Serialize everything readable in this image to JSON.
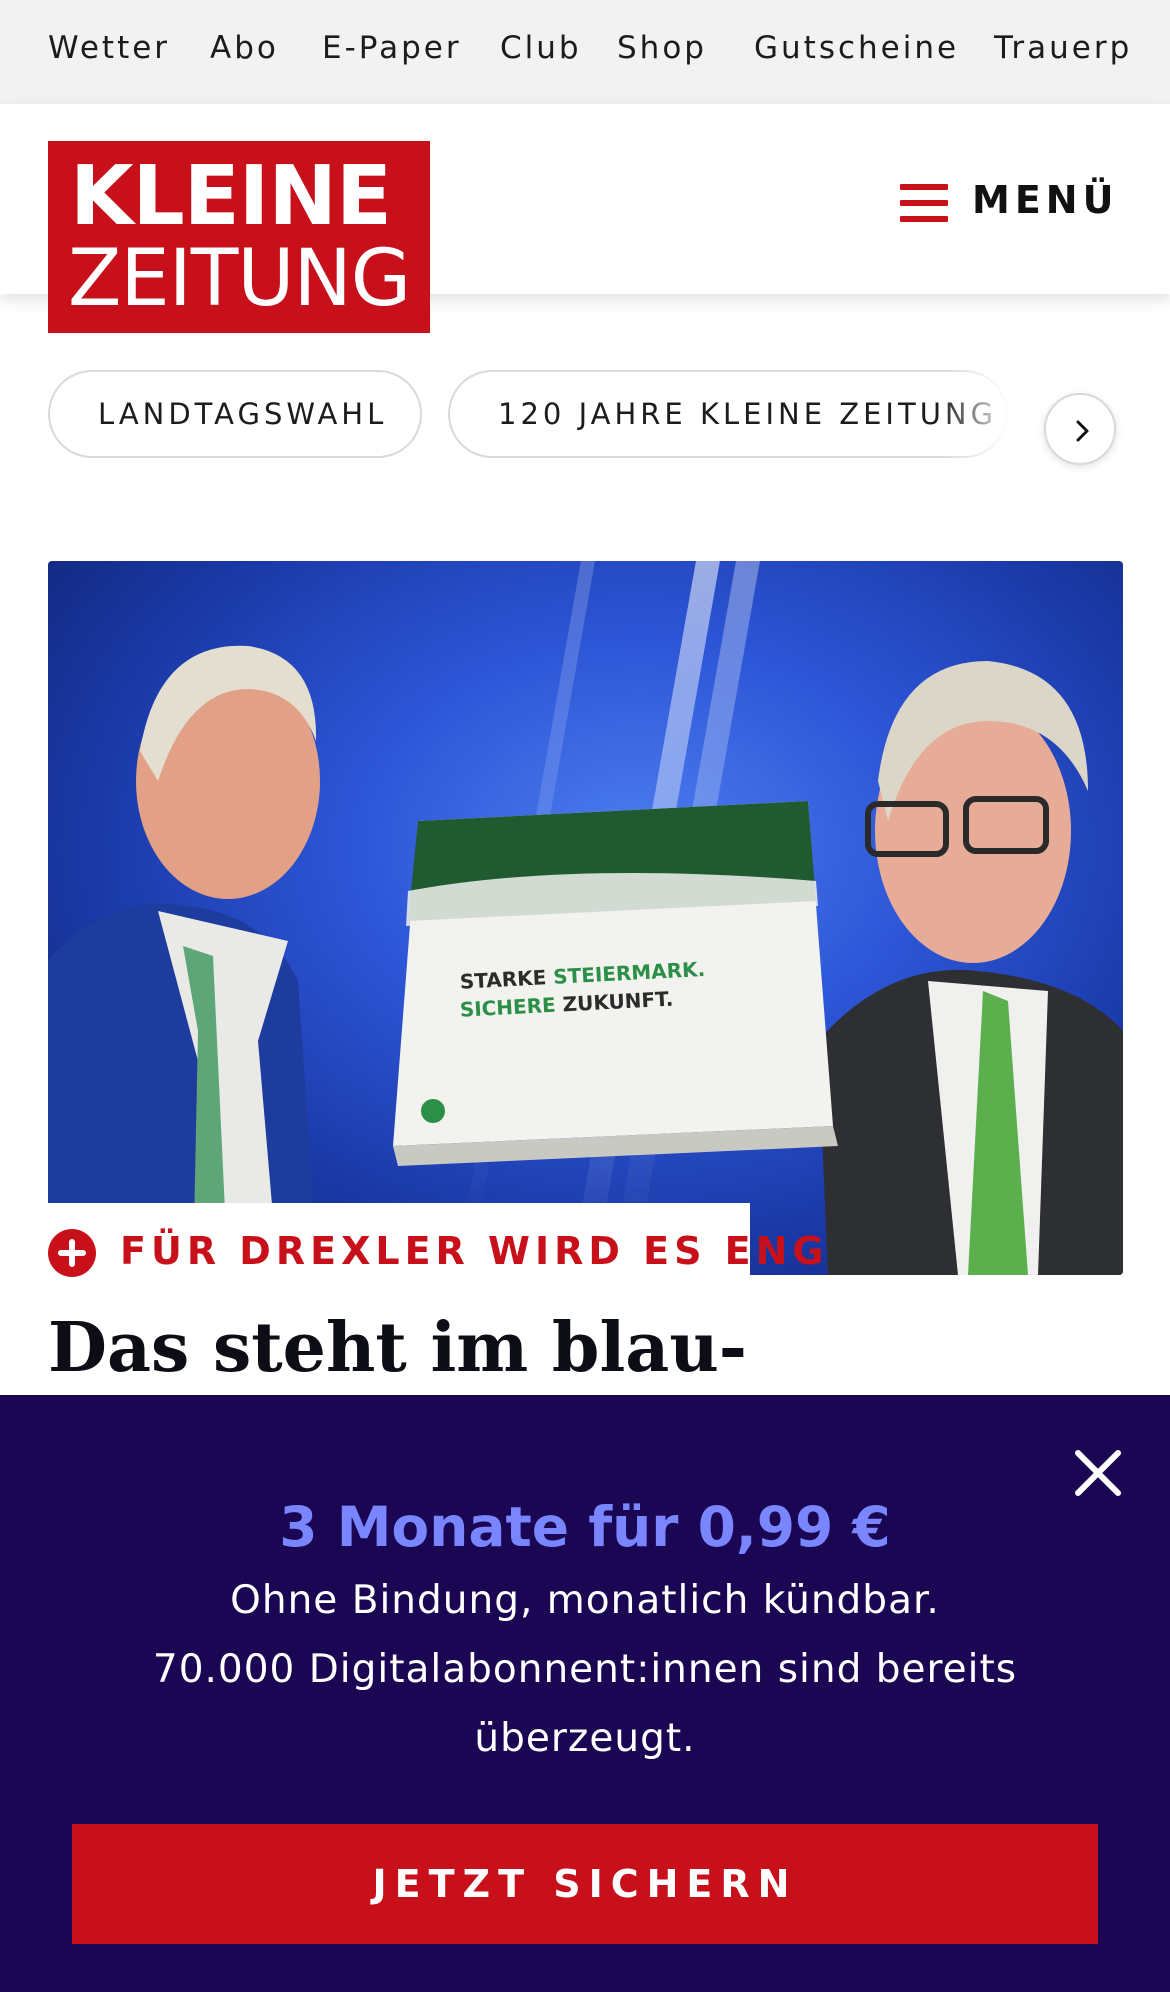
{
  "topbar": {
    "items": [
      "Wetter",
      "Abo",
      "E-Paper",
      "Club",
      "Shop",
      "Gutscheine",
      "Trauerp"
    ]
  },
  "header": {
    "logo_line1": "KLEINE",
    "logo_line2": "ZEITUNG",
    "menu_label": "MENÜ",
    "brand_color": "#c8101a"
  },
  "chips": {
    "items": [
      "LANDTAGSWAHL",
      "120 JAHRE KLEINE ZEITUNG"
    ],
    "next_icon": "chevron-right-icon"
  },
  "article": {
    "kicker": "FÜR DREXLER WIRD ES ENG",
    "headline": "Das steht im blau-"
  },
  "promo": {
    "title": "3 Monate für 0,99 €",
    "line1": "Ohne Bindung, monatlich kündbar.",
    "line2": "70.000 Digitalabonnent:innen sind bereits",
    "line3": "überzeugt.",
    "cta_label": "JETZT SICHERN",
    "close_icon": "close-icon",
    "background_color": "#1a0652",
    "title_color": "#7a86ff"
  }
}
